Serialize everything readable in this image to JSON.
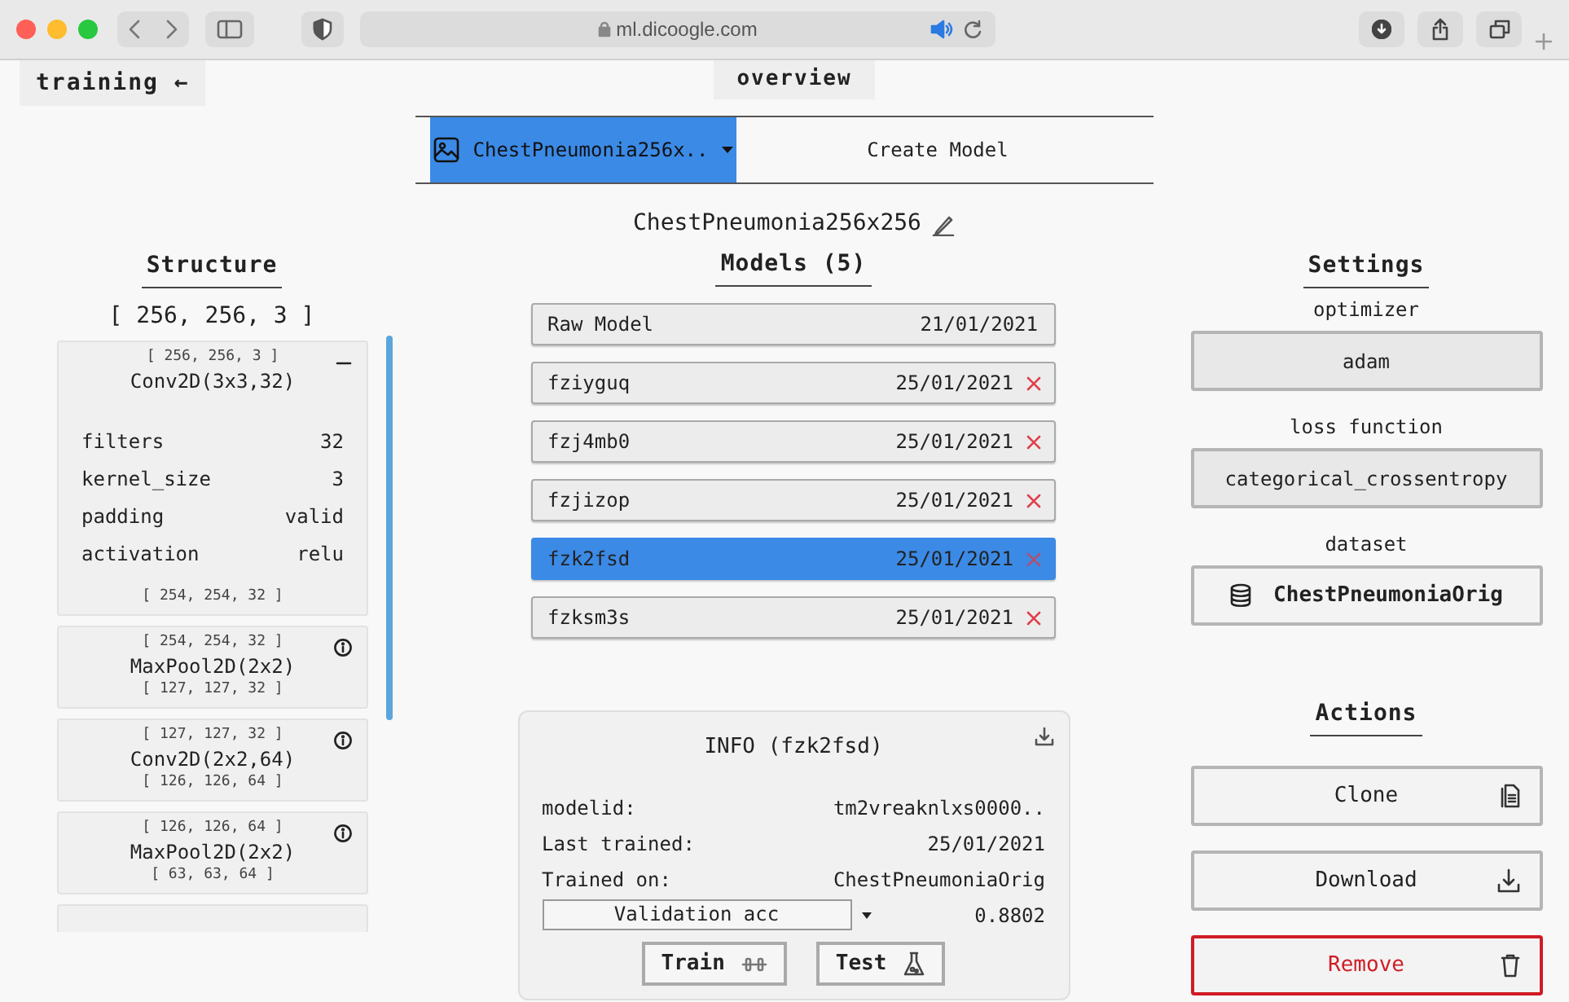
{
  "browser": {
    "url": "ml.dicoogle.com"
  },
  "nav": {
    "back_label": "training ←",
    "page_title": "overview"
  },
  "tabs": [
    {
      "label": "ChestPneumonia256x..",
      "selected": true,
      "kind": "dropdown"
    },
    {
      "label": "Create Model",
      "selected": false,
      "kind": "plain"
    }
  ],
  "dataset_title": "ChestPneumonia256x256",
  "structure": {
    "heading": "Structure",
    "input_shape": "[ 256, 256, 3 ]",
    "layers": [
      {
        "input": "[ 256, 256, 3 ]",
        "name": "Conv2D(3x3,32)",
        "output": "[ 254, 254, 32 ]",
        "expanded": true,
        "params": [
          {
            "key": "filters",
            "value": "32"
          },
          {
            "key": "kernel_size",
            "value": "3"
          },
          {
            "key": "padding",
            "value": "valid"
          },
          {
            "key": "activation",
            "value": "relu"
          }
        ]
      },
      {
        "input": "[ 254, 254, 32 ]",
        "name": "MaxPool2D(2x2)",
        "output": "[ 127, 127, 32 ]",
        "expanded": false
      },
      {
        "input": "[ 127, 127, 32 ]",
        "name": "Conv2D(2x2,64)",
        "output": "[ 126, 126, 64 ]",
        "expanded": false
      },
      {
        "input": "[ 126, 126, 64 ]",
        "name": "MaxPool2D(2x2)",
        "output": "[ 63, 63, 64 ]",
        "expanded": false
      }
    ]
  },
  "models": {
    "heading": "Models (5)",
    "items": [
      {
        "name": "Raw Model",
        "date": "21/01/2021",
        "removable": false,
        "selected": false
      },
      {
        "name": "fziyguq",
        "date": "25/01/2021",
        "removable": true,
        "selected": false
      },
      {
        "name": "fzj4mb0",
        "date": "25/01/2021",
        "removable": true,
        "selected": false
      },
      {
        "name": "fzjizop",
        "date": "25/01/2021",
        "removable": true,
        "selected": false
      },
      {
        "name": "fzk2fsd",
        "date": "25/01/2021",
        "removable": true,
        "selected": true
      },
      {
        "name": "fzksm3s",
        "date": "25/01/2021",
        "removable": true,
        "selected": false
      }
    ]
  },
  "info": {
    "title": "INFO (fzk2fsd)",
    "fields": [
      {
        "label": "modelid:",
        "value": "tm2vreaknlxs0000.."
      },
      {
        "label": "Last trained:",
        "value": "25/01/2021"
      },
      {
        "label": "Trained on:",
        "value": "ChestPneumoniaOrig"
      }
    ],
    "metric": {
      "label": "Validation acc",
      "value": "0.8802"
    },
    "buttons": [
      {
        "label": "Train",
        "kind": "train"
      },
      {
        "label": "Test",
        "kind": "test"
      }
    ]
  },
  "settings": {
    "heading": "Settings",
    "fields": [
      {
        "label": "optimizer",
        "value": "adam",
        "kind": "select"
      },
      {
        "label": "loss function",
        "value": "categorical_crossentropy",
        "kind": "select"
      },
      {
        "label": "dataset",
        "value": "ChestPneumoniaOrig",
        "kind": "dataset"
      }
    ]
  },
  "actions": {
    "heading": "Actions",
    "buttons": [
      {
        "label": "Clone",
        "kind": "clone"
      },
      {
        "label": "Download",
        "kind": "download"
      },
      {
        "label": "Remove",
        "kind": "remove"
      }
    ]
  }
}
